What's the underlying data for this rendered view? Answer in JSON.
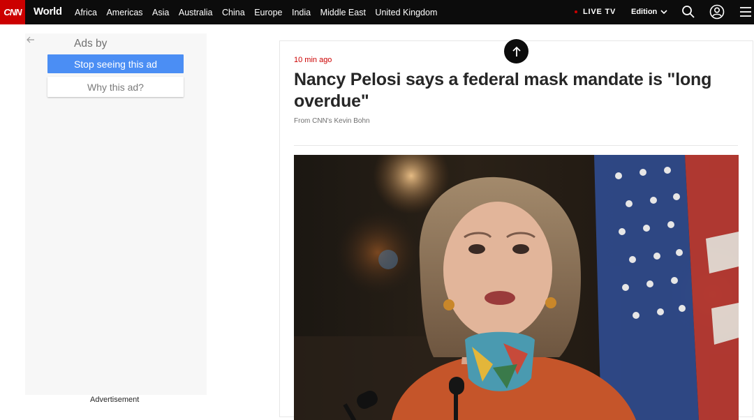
{
  "header": {
    "logo_text": "CNN",
    "section_title": "World",
    "nav_items": [
      {
        "label": "Africa"
      },
      {
        "label": "Americas"
      },
      {
        "label": "Asia"
      },
      {
        "label": "Australia"
      },
      {
        "label": "China"
      },
      {
        "label": "Europe"
      },
      {
        "label": "India"
      },
      {
        "label": "Middle East"
      },
      {
        "label": "United Kingdom"
      }
    ],
    "live_tv_label": "LIVE TV",
    "edition_label": "Edition",
    "icons": [
      "search-icon",
      "account-icon",
      "menu-icon"
    ]
  },
  "ad": {
    "ads_by_label": "Ads by",
    "stop_label": "Stop seeing this ad",
    "why_label": "Why this ad?",
    "advertisement_label": "Advertisement"
  },
  "article": {
    "timestamp": "10 min ago",
    "headline": "Nancy Pelosi says a federal mask mandate is \"long overdue\"",
    "byline": "From CNN's Kevin Bohn"
  },
  "colors": {
    "brand_red": "#cc0000",
    "nav_bg": "#0c0c0c",
    "ad_button_blue": "#4b8ef4"
  }
}
